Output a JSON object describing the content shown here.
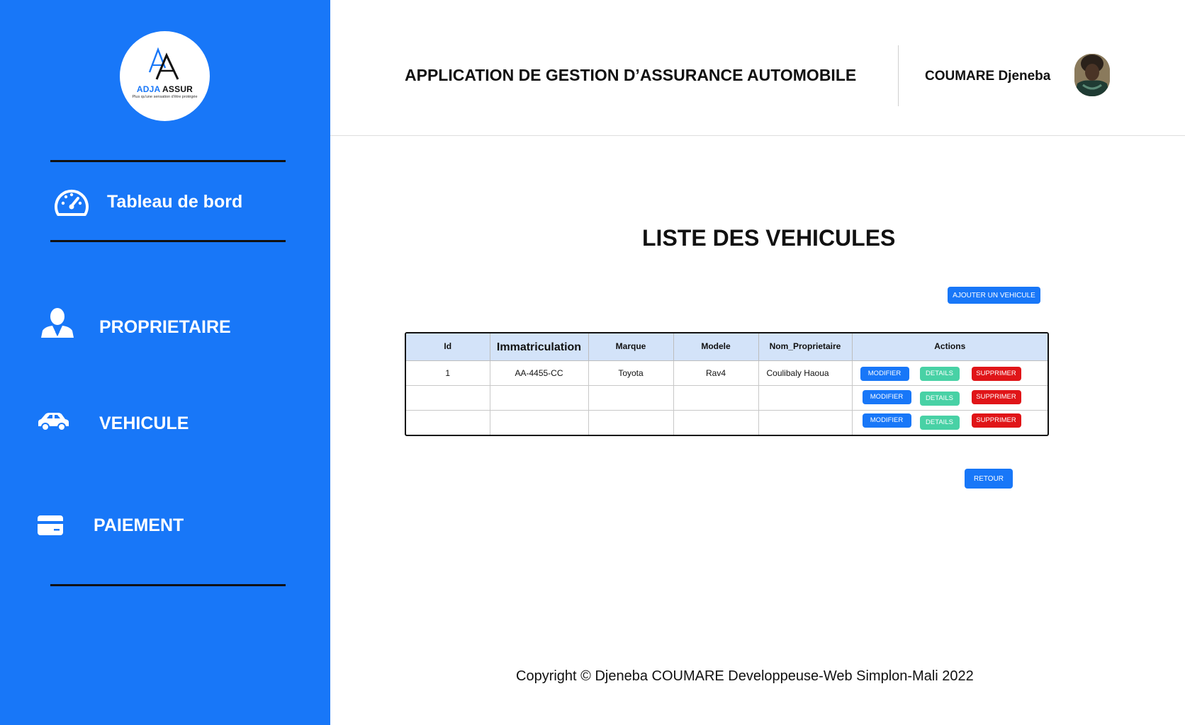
{
  "sidebar": {
    "logo": {
      "name_part1": "ADJA",
      "name_part2": "ASSUR",
      "tagline": "Plus qu'une sensation d'être protégée",
      "brand_color": "#1877f8"
    },
    "items": [
      {
        "label": "Tableau de bord",
        "icon": "dashboard-gauge-icon"
      },
      {
        "label": "PROPRIETAIRE",
        "icon": "user-icon"
      },
      {
        "label": "VEHICULE",
        "icon": "car-icon"
      },
      {
        "label": "PAIEMENT",
        "icon": "credit-card-icon"
      }
    ],
    "background": "#1877f8"
  },
  "header": {
    "title": "APPLICATION DE GESTION D’ASSURANCE AUTOMOBILE",
    "user_name": "COUMARE Djeneba",
    "avatar_icon": "user-avatar"
  },
  "main": {
    "title": "LISTE DES VEHICULES",
    "add_button": "AJOUTER UN VEHICULE",
    "back_button": "RETOUR",
    "table": {
      "headers": [
        "Id",
        "Immatriculation",
        "Marque",
        "Modele",
        "Nom_Proprietaire",
        "Actions"
      ],
      "rows": [
        {
          "id": "1",
          "immatriculation": "AA-4455-CC",
          "marque": "Toyota",
          "modele": "Rav4",
          "proprietaire": "Coulibaly Haoua"
        },
        {
          "id": "",
          "immatriculation": "",
          "marque": "",
          "modele": "",
          "proprietaire": ""
        },
        {
          "id": "",
          "immatriculation": "",
          "marque": "",
          "modele": "",
          "proprietaire": ""
        }
      ],
      "action_labels": {
        "modify": "MODIFIER",
        "details": "DETAILS",
        "delete": "SUPPRIMER"
      },
      "action_colors": {
        "modify": "#1877f8",
        "details": "#48d1a5",
        "delete": "#e01518"
      }
    }
  },
  "footer": {
    "text": "Copyright © Djeneba COUMARE Developpeuse-Web Simplon-Mali 2022"
  }
}
